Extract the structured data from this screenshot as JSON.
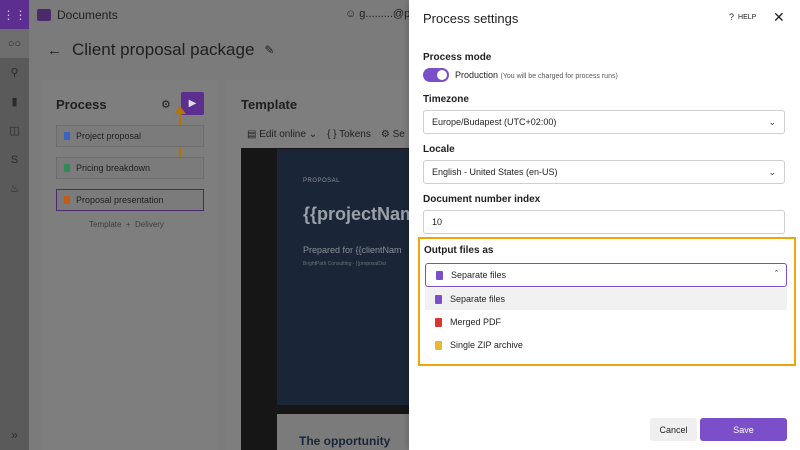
{
  "app": {
    "name": "Documents",
    "user": "g.........@plu"
  },
  "page": {
    "title": "Client proposal package"
  },
  "process": {
    "title": "Process",
    "steps": [
      {
        "label": "Project proposal",
        "icon": "word-doc-icon",
        "color": "#3b63c4"
      },
      {
        "label": "Pricing breakdown",
        "icon": "sheet-icon",
        "color": "#2e8b57"
      },
      {
        "label": "Proposal presentation",
        "icon": "slides-icon",
        "color": "#c55a11"
      }
    ],
    "template_label": "Template",
    "delivery_label": "Delivery"
  },
  "template": {
    "title": "Template",
    "toolbar": {
      "edit_online": "Edit online",
      "tokens": "Tokens",
      "settings_partial": "Se"
    },
    "slide": {
      "tag": "PROPOSAL",
      "headline": "{{projectNam",
      "prepared": "Prepared for {{clientNam",
      "sub": "BrightPath Consulting · {{proposalDat",
      "next_heading": "The opportunity"
    }
  },
  "panel": {
    "title": "Process settings",
    "help": "HELP",
    "process_mode": {
      "label": "Process mode",
      "value": "Production",
      "note": "(You will be charged for process runs)"
    },
    "timezone": {
      "label": "Timezone",
      "value": "Europe/Budapest (UTC+02:00)"
    },
    "locale": {
      "label": "Locale",
      "value": "English - United States (en-US)"
    },
    "doc_index": {
      "label": "Document number index",
      "value": "10"
    },
    "output": {
      "label": "Output files as",
      "selected": "Separate files",
      "options": [
        {
          "label": "Separate files",
          "color": "#7a4fc9"
        },
        {
          "label": "Merged PDF",
          "color": "#d9372e"
        },
        {
          "label": "Single ZIP archive",
          "color": "#e8b92e"
        }
      ]
    },
    "cancel": "Cancel",
    "save": "Save"
  },
  "colors": {
    "accent": "#7a4fc9",
    "highlight": "#f0a30a"
  }
}
